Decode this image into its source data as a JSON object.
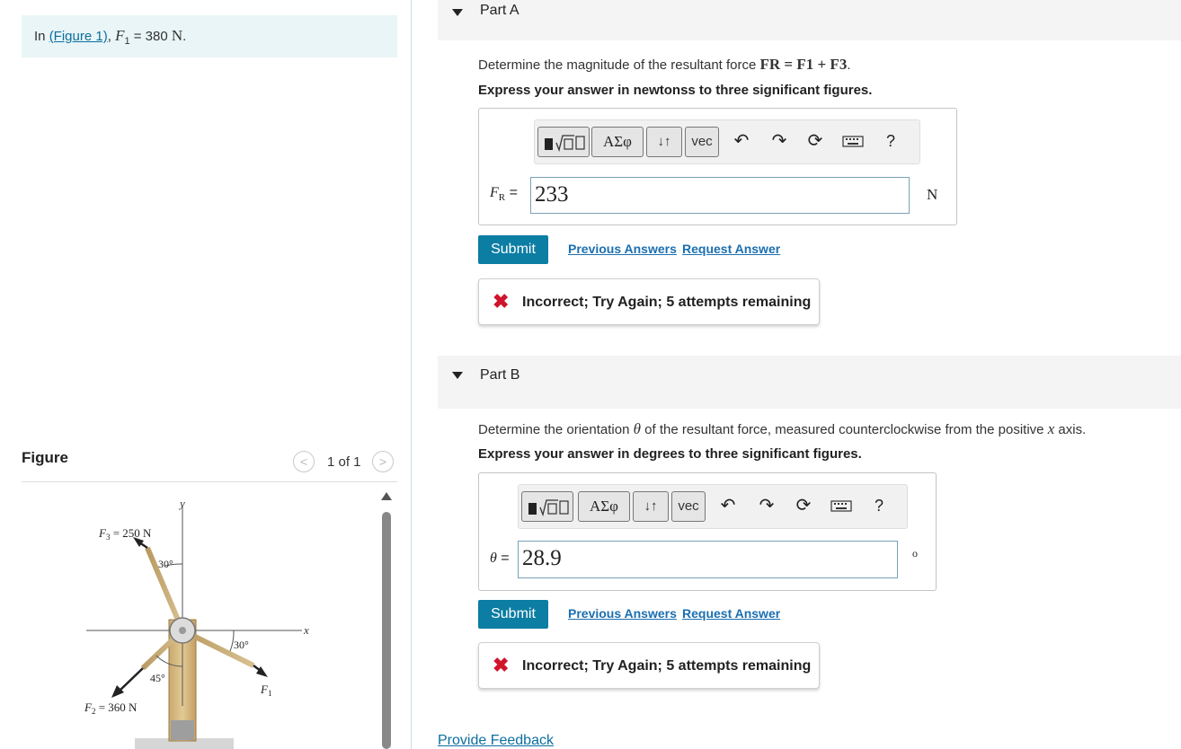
{
  "intro": {
    "prefix": "In ",
    "figure_link": "(Figure 1)",
    "comma": ", ",
    "force_symbol": "F",
    "force_subscript": "1",
    "equals": " = 380 ",
    "unit": "N",
    "period": "."
  },
  "figure": {
    "title": "Figure",
    "counter": "1 of 1",
    "prev_icon": "chevron-left-icon",
    "next_icon": "chevron-right-icon",
    "labels": {
      "y_axis": "y",
      "x_axis": "x",
      "f3_sym": "F",
      "f3_sub": "3",
      "f3_val": " = 250 N",
      "angle_f3": "30°",
      "angle_f1": "30°",
      "angle_f2": "45°",
      "f2_sym": "F",
      "f2_sub": "2",
      "f2_val": " = 360 N",
      "f1_sym": "F",
      "f1_sub": "1"
    }
  },
  "toolbar": {
    "greek_label": "ΑΣφ",
    "updown_label": "↓↑",
    "vec_label": "vec",
    "undo_icon": "undo-icon",
    "redo_icon": "redo-icon",
    "reset_icon": "reset-icon",
    "keyboard_icon": "keyboard-icon",
    "help_label": "?"
  },
  "part_a": {
    "title": "Part A",
    "question_text": "Determine the magnitude of the resultant force ",
    "question_formula": "FR = F1 + F3",
    "question_end": ".",
    "instruction": "Express your answer in newtonss to three significant figures.",
    "answer_label_sym": "F",
    "answer_label_sub": "R",
    "answer_label_eq": " =",
    "answer_value": "233",
    "unit": "N",
    "submit_label": "Submit",
    "previous_answers": "Previous Answers",
    "request_answer": "Request Answer",
    "feedback": "Incorrect; Try Again; 5 attempts remaining",
    "feedback_icon": "x-icon"
  },
  "part_b": {
    "title": "Part B",
    "question_text": "Determine the orientation ",
    "question_theta": "θ",
    "question_mid": " of the resultant force, measured counterclockwise from the positive ",
    "question_x": "x",
    "question_end": " axis.",
    "instruction": "Express your answer in degrees to three significant figures.",
    "answer_label_sym": "θ",
    "answer_label_eq": " =",
    "answer_value": "28.9",
    "unit": "o",
    "submit_label": "Submit",
    "previous_answers": "Previous Answers",
    "request_answer": "Request Answer",
    "feedback": "Incorrect; Try Again; 5 attempts remaining",
    "feedback_icon": "x-icon"
  },
  "footer": {
    "provide_feedback": "Provide Feedback"
  }
}
